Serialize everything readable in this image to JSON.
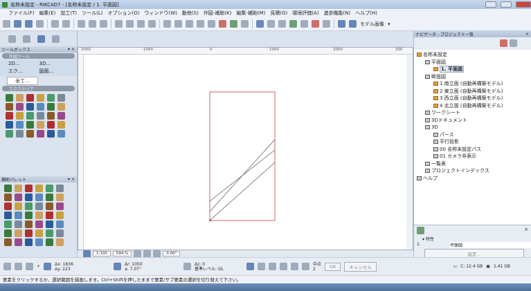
{
  "window": {
    "title": "名称未設定 - RIKCAD7 - [名称未設定 / 1. 平面図]"
  },
  "menu": [
    "ファイル(F)",
    "編集(E)",
    "加工(T)",
    "ツール(L)",
    "オプション(O)",
    "ウィンドウ(W)",
    "動他(S)",
    "作図-補助(K)",
    "編集-補助(M)",
    "見積(G)",
    "環境評価(A)",
    "進歩機能(N)",
    "ヘルプ(H)"
  ],
  "toolbar": {
    "display_mode": "モデル画像"
  },
  "toolbox": {
    "title": "ツールボックス",
    "group1": "作図ツール",
    "buttons": [
      "2D...",
      "3D...",
      "エク...",
      "図面..."
    ],
    "all_button": "全て...",
    "group2": "エクステリア"
  },
  "palette": {
    "title": "補助パレット"
  },
  "ruler": {
    "labels": [
      "2000",
      "-1000",
      "0",
      "1000",
      "2000",
      "300"
    ]
  },
  "canvas_bar": {
    "scale": "1:100",
    "zoom": "594 %",
    "angle": "0.00°"
  },
  "navigator": {
    "title": "ナビゲータ - プロジェクト一覧",
    "tree": [
      {
        "label": "名称未設定",
        "depth": 0,
        "icon": "house"
      },
      {
        "label": "平面図",
        "depth": 1,
        "icon": "view"
      },
      {
        "label": "1. 平面図",
        "depth": 2,
        "icon": "house",
        "selected": true
      },
      {
        "label": "断面図",
        "depth": 1,
        "icon": "view"
      },
      {
        "label": "1 南立面 (自動再構築モデル)",
        "depth": 2,
        "icon": "house"
      },
      {
        "label": "2 東立面 (自動再構築モデル)",
        "depth": 2,
        "icon": "house"
      },
      {
        "label": "3 西立面 (自動再構築モデル)",
        "depth": 2,
        "icon": "house"
      },
      {
        "label": "4 北立面 (自動再構築モデル)",
        "depth": 2,
        "icon": "house"
      },
      {
        "label": "ワークシート",
        "depth": 1,
        "icon": "view"
      },
      {
        "label": "3Dドキュメント",
        "depth": 1,
        "icon": "view"
      },
      {
        "label": "3D",
        "depth": 1,
        "icon": "view"
      },
      {
        "label": "パース",
        "depth": 2,
        "icon": "cam"
      },
      {
        "label": "平行投影",
        "depth": 2,
        "icon": "cam"
      },
      {
        "label": "00 名称未設定パス",
        "depth": 2,
        "icon": "cam"
      },
      {
        "label": "01 カメラ非表示",
        "depth": 2,
        "icon": "cam"
      },
      {
        "label": "一覧表",
        "depth": 1,
        "icon": "view"
      },
      {
        "label": "プロジェクトインデックス",
        "depth": 1,
        "icon": "view"
      },
      {
        "label": "ヘルプ",
        "depth": 0,
        "icon": "view"
      }
    ]
  },
  "properties": {
    "section": "特性",
    "id": "1.",
    "name": "平面図",
    "settings_button": "設定..."
  },
  "infobox": {
    "dx": "Δx: 1836",
    "dy": "Δy: 223",
    "dr": "Δr: 1050",
    "da": "a: 7.07°",
    "dz": "Δz: 0",
    "level": "基準レベル: GL",
    "midpoint": "中点",
    "midpoint_n": "2",
    "ok": "OK",
    "cancel": "キャンセル"
  },
  "status": {
    "message": "要素をクリックするか、選択範囲を描画します。Ctrl+Shiftを押したままで要素/サブ要素の選択を切り替えて下さい。",
    "disk_c": "C: 12.4 GB",
    "memory": "1.41 GB"
  }
}
